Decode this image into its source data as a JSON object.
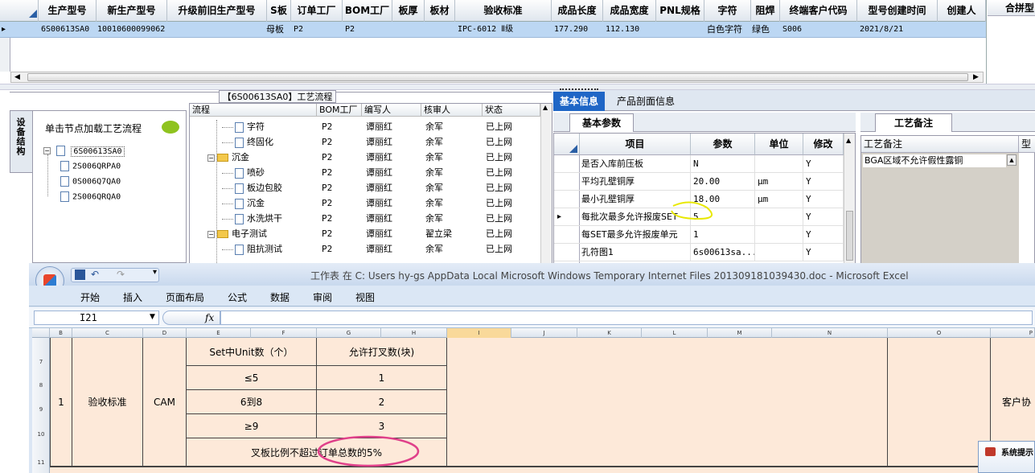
{
  "top_grid": {
    "columns": [
      "生产型号",
      "新生产型号",
      "升级前旧生产型号",
      "S板",
      "订单工厂",
      "BOM工厂",
      "板厚",
      "板材",
      "验收标准",
      "成品长度",
      "成品宽度",
      "PNL规格",
      "字符",
      "阻焊",
      "终端客户代码",
      "型号创建时间",
      "创建人"
    ],
    "row": [
      "6S00613SA0",
      "10010600099062",
      "",
      "母板",
      "P2",
      "P2",
      "",
      "",
      "IPC-6012 Ⅱ级",
      "177.290",
      "112.130",
      "",
      "白色字符",
      "绿色",
      "S006",
      "2021/8/21",
      ""
    ],
    "row_marker": "▸",
    "right_header": "合拼型"
  },
  "flow_panel": {
    "title": "【6S00613SA0】工艺流程",
    "side_tab": "设备结构",
    "hint": "单击节点加载工艺流程",
    "tree": {
      "root": "6S00613SA0",
      "children": [
        "2S006QRPA0",
        "0S006Q7QA0",
        "2S006QRQA0"
      ]
    },
    "columns": [
      "流程",
      "BOM工厂",
      "编写人",
      "核审人",
      "状态"
    ],
    "rows": [
      {
        "name": "字符",
        "type": "doc",
        "level": 2,
        "bom": "P2",
        "writer": "谭丽红",
        "reviewer": "余军",
        "status": "已上网"
      },
      {
        "name": "终固化",
        "type": "doc",
        "level": 2,
        "bom": "P2",
        "writer": "谭丽红",
        "reviewer": "余军",
        "status": "已上网"
      },
      {
        "name": "沉金",
        "type": "folder",
        "level": 1,
        "bom": "P2",
        "writer": "谭丽红",
        "reviewer": "余军",
        "status": "已上网"
      },
      {
        "name": "喷砂",
        "type": "doc",
        "level": 2,
        "bom": "P2",
        "writer": "谭丽红",
        "reviewer": "余军",
        "status": "已上网"
      },
      {
        "name": "板边包胶",
        "type": "doc",
        "level": 2,
        "bom": "P2",
        "writer": "谭丽红",
        "reviewer": "余军",
        "status": "已上网"
      },
      {
        "name": "沉金",
        "type": "doc",
        "level": 2,
        "bom": "P2",
        "writer": "谭丽红",
        "reviewer": "余军",
        "status": "已上网"
      },
      {
        "name": "水洗烘干",
        "type": "doc",
        "level": 2,
        "bom": "P2",
        "writer": "谭丽红",
        "reviewer": "余军",
        "status": "已上网"
      },
      {
        "name": "电子测试",
        "type": "folder",
        "level": 1,
        "bom": "P2",
        "writer": "谭丽红",
        "reviewer": "翟立梁",
        "status": "已上网"
      },
      {
        "name": "阻抗测试",
        "type": "doc",
        "level": 2,
        "bom": "P2",
        "writer": "谭丽红",
        "reviewer": "余军",
        "status": "已上网"
      }
    ]
  },
  "info_panel": {
    "tabs": [
      "基本信息",
      "产品剖面信息"
    ],
    "subtab": "基本参数",
    "notes_tab": "工艺备注",
    "columns": [
      "项目",
      "参数",
      "单位",
      "修改"
    ],
    "rows": [
      {
        "item": "是否入库前压板",
        "value": "N",
        "unit": "",
        "edit": "Y"
      },
      {
        "item": "平均孔壁铜厚",
        "value": "20.00",
        "unit": "μm",
        "edit": "Y"
      },
      {
        "item": "最小孔壁铜厚",
        "value": "18.00",
        "unit": "μm",
        "edit": "Y"
      },
      {
        "item": "每批次最多允许报废SET",
        "value": "5",
        "unit": "",
        "edit": "Y"
      },
      {
        "item": "每SET最多允许报废单元",
        "value": "1",
        "unit": "",
        "edit": "Y"
      },
      {
        "item": "孔符图1",
        "value": "6s00613sa...",
        "unit": "",
        "edit": "Y"
      }
    ],
    "notes_header": "工艺备注",
    "notes_header2": "型号",
    "notes_text": "BGA区域不允许假性露铜"
  },
  "excel": {
    "title": "工作表 在 C: Users hy-gs AppData Local Microsoft Windows Temporary Internet Files 201309181039430.doc - Microsoft Excel",
    "menu": [
      "开始",
      "插入",
      "页面布局",
      "公式",
      "数据",
      "审阅",
      "视图"
    ],
    "name_box": "I21",
    "fx": "fx",
    "col_headers": [
      "B",
      "C",
      "D",
      "E",
      "F",
      "G",
      "H",
      "I",
      "J",
      "K",
      "L",
      "M",
      "N",
      "O",
      "P"
    ],
    "row_headers": [
      "7",
      "8",
      "9",
      "10",
      "11"
    ],
    "cells": {
      "b_num": "1",
      "c_label": "验收标准",
      "d_label": "CAM",
      "hdr_left": "Set中Unit数（个）",
      "hdr_right": "允许打叉数(块)",
      "r1_left": "≤5",
      "r1_right": "1",
      "r2_left": "6到8",
      "r2_right": "2",
      "r3_left": "≥9",
      "r3_right": "3",
      "note": "叉板比例不超过订单总数的5%",
      "right_text": "客户协"
    },
    "popup": "系统提示"
  }
}
